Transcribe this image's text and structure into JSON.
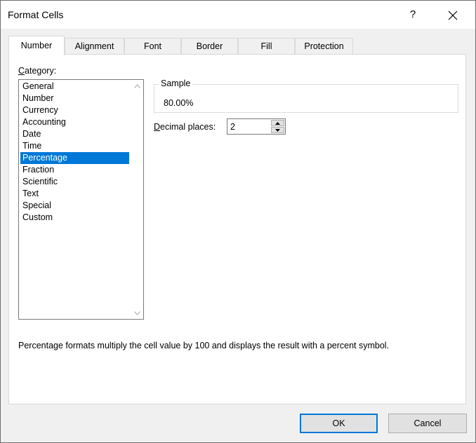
{
  "window": {
    "title": "Format Cells",
    "help_label": "?",
    "close_icon": "close-icon"
  },
  "tabs": [
    {
      "label": "Number",
      "active": true
    },
    {
      "label": "Alignment",
      "active": false
    },
    {
      "label": "Font",
      "active": false
    },
    {
      "label": "Border",
      "active": false
    },
    {
      "label": "Fill",
      "active": false
    },
    {
      "label": "Protection",
      "active": false
    }
  ],
  "category": {
    "label_first": "C",
    "label_rest": "ategory:",
    "items": [
      "General",
      "Number",
      "Currency",
      "Accounting",
      "Date",
      "Time",
      "Percentage",
      "Fraction",
      "Scientific",
      "Text",
      "Special",
      "Custom"
    ],
    "selected": "Percentage"
  },
  "sample": {
    "legend": "Sample",
    "value": "80.00%"
  },
  "decimal_places": {
    "label_first": "D",
    "label_rest": "ecimal places:",
    "value": "2"
  },
  "description": "Percentage formats multiply the cell value by 100 and displays the result with a percent symbol.",
  "buttons": {
    "ok": "OK",
    "cancel": "Cancel"
  },
  "colors": {
    "selection": "#0078d7",
    "dialog_bg": "#f0f0f0",
    "panel_bg": "#ffffff"
  }
}
